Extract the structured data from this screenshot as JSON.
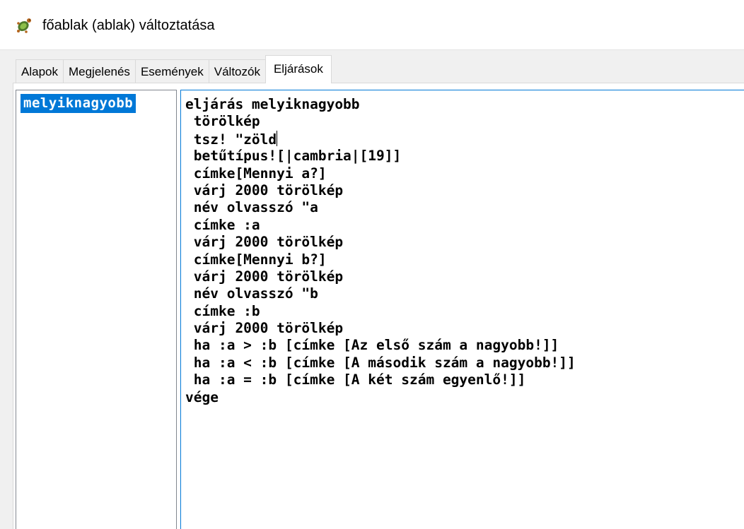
{
  "window": {
    "title": "főablak (ablak) változtatása",
    "icon": "turtle-app-icon"
  },
  "tabs": [
    {
      "label": "Alapok",
      "active": false
    },
    {
      "label": "Megjelenés",
      "active": false
    },
    {
      "label": "Események",
      "active": false
    },
    {
      "label": "Változók",
      "active": false
    },
    {
      "label": "Eljárások",
      "active": true
    }
  ],
  "procedures": {
    "items": [
      "melyiknagyobb"
    ],
    "selected": "melyiknagyobb"
  },
  "editor": {
    "lines": [
      "eljárás melyiknagyobb",
      " törölkép",
      " tsz! \"zöld",
      " betűtípus![|cambria|[19]]",
      " címke[Mennyi a?]",
      " várj 2000 törölkép",
      " név olvasszó \"a",
      " címke :a",
      " várj 2000 törölkép",
      " címke[Mennyi b?]",
      " várj 2000 törölkép",
      " név olvasszó \"b",
      " címke :b",
      " várj 2000 törölkép",
      " ha :a > :b [címke [Az első szám a nagyobb!]]",
      " ha :a < :b [címke [A második szám a nagyobb!]]",
      " ha :a = :b [címke [A két szám egyenlő!]]",
      "vége"
    ],
    "caret_line": 2
  },
  "colors": {
    "selection": "#0078d7",
    "focus_border": "#0078d7",
    "window_bg": "#f0f0f0"
  }
}
